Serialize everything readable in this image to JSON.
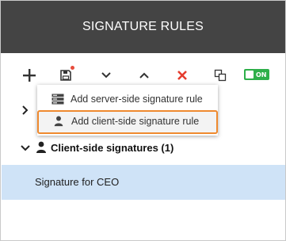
{
  "header": {
    "title": "SIGNATURE RULES"
  },
  "toolbar": {
    "add_icon": "plus-icon",
    "save_icon": "save-icon",
    "save_has_unsaved_indicator": true,
    "move_down_icon": "chevron-down-icon",
    "move_up_icon": "chevron-up-icon",
    "delete_icon": "close-icon",
    "copy_icon": "copy-icon",
    "toggle": {
      "label": "ON",
      "state": "on",
      "color": "#2eaf4a"
    }
  },
  "add_menu": {
    "items": [
      {
        "label": "Add server-side signature rule",
        "icon": "server-icon"
      },
      {
        "label": "Add client-side signature rule",
        "icon": "user-icon",
        "highlighted": true
      }
    ],
    "highlight_color": "#ef8a2f"
  },
  "tree": {
    "client_group": {
      "label": "Client-side signatures (1)",
      "icon": "user-icon",
      "expanded": true
    },
    "selected_item": {
      "label": "Signature for CEO",
      "selected_color": "#cfe3f7"
    }
  },
  "colors": {
    "header_bg": "#444444",
    "delete_red": "#e53c2e"
  }
}
